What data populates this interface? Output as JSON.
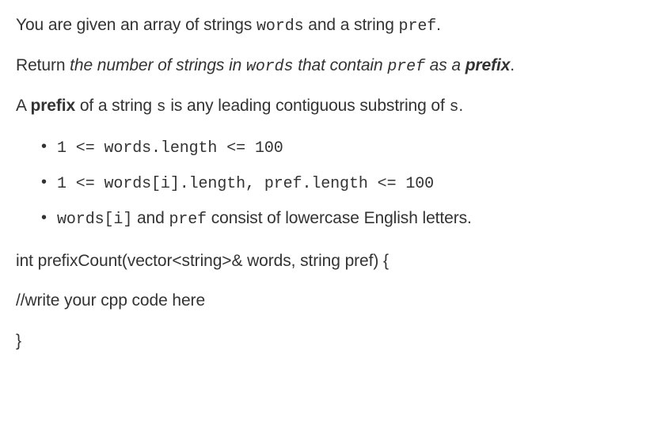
{
  "para1": {
    "pre": "You are given an array of strings ",
    "code1": "words",
    "mid": " and a string ",
    "code2": "pref",
    "post": "."
  },
  "para2": {
    "pre": "Return ",
    "em1": "the number of strings in ",
    "code1": "words",
    "em2": " that contain ",
    "code2": "pref",
    "em3": " as a ",
    "strong": "prefix",
    "post": "."
  },
  "para3": {
    "pre": "A ",
    "strong": "prefix",
    "mid": " of a string ",
    "code1": "s",
    "mid2": " is any leading contiguous substring of ",
    "code2": "s",
    "post": "."
  },
  "constraints": [
    {
      "code": "1 <= words.length <= 100",
      "text": ""
    },
    {
      "code": "1 <= words[i].length, pref.length <= 100",
      "text": ""
    },
    {
      "code1": "words[i]",
      "mid": " and ",
      "code2": "pref",
      "text": " consist of lowercase English letters."
    }
  ],
  "signature": "int prefixCount(vector<string>& words, string pref) {",
  "comment": "//write your cpp code here",
  "closing": "}"
}
